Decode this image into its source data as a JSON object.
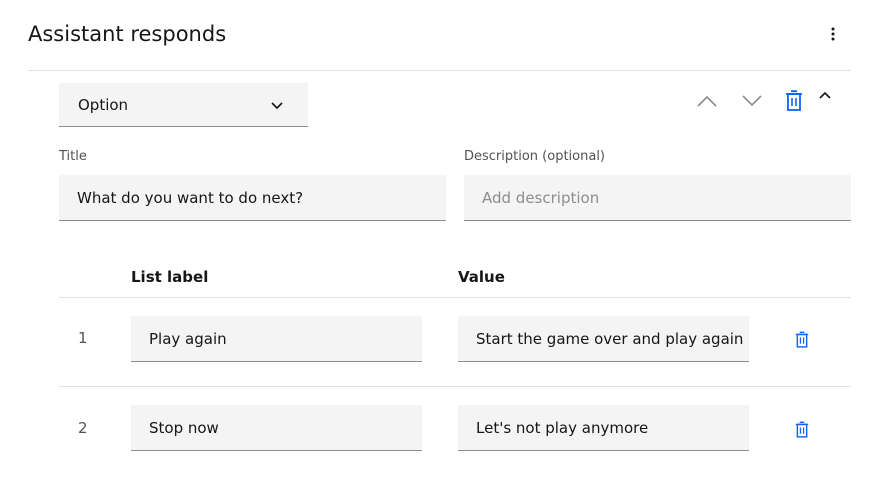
{
  "header": {
    "title": "Assistant responds"
  },
  "response_type": {
    "selected": "Option"
  },
  "fields": {
    "title_label": "Title",
    "title_value": "What do you want to do next?",
    "description_label": "Description (optional)",
    "description_placeholder": "Add description"
  },
  "list": {
    "headers": {
      "label": "List label",
      "value": "Value"
    },
    "rows": [
      {
        "number": "1",
        "label": "Play again",
        "value": "Start the game over and play again"
      },
      {
        "number": "2",
        "label": "Stop now",
        "value": "Let's not play anymore"
      }
    ]
  },
  "colors": {
    "accent": "#0f62fe",
    "icon_gray": "#8d8d8d",
    "field_bg": "#f4f4f4"
  },
  "icons": [
    "overflow-menu-icon",
    "chevron-down-icon",
    "chevron-up-icon",
    "trash-icon"
  ]
}
